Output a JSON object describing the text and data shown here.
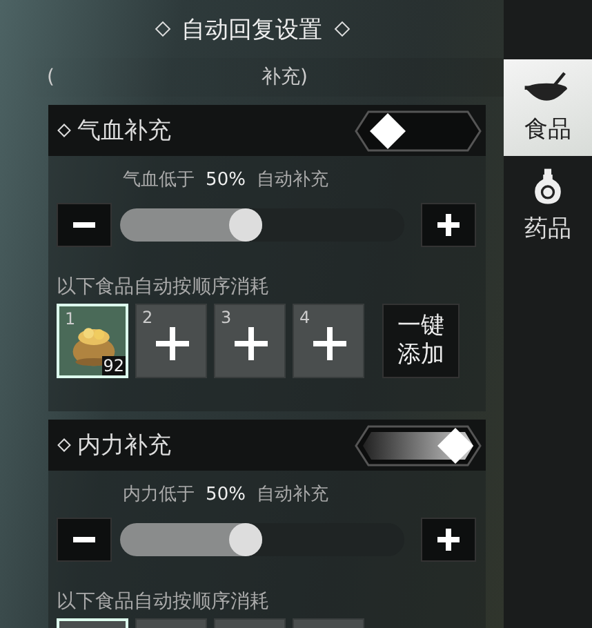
{
  "title": "自动回复设置",
  "note_fragments": [
    "(",
    "补充)"
  ],
  "tabs": [
    {
      "label": "食品",
      "selected": true,
      "kind": "bowl"
    },
    {
      "label": "药品",
      "selected": false,
      "kind": "bottle"
    }
  ],
  "sections": [
    {
      "title": "气血补充",
      "on": false,
      "threshold_label": "气血低于",
      "threshold_value": "50%",
      "threshold_suffix": "自动补充",
      "level": 0.5,
      "items_label": "以下食品自动按顺序消耗",
      "slots": [
        {
          "number": "1",
          "kind": "item",
          "count": "92",
          "selected": true
        },
        {
          "number": "2",
          "kind": "empty",
          "selected": false
        },
        {
          "number": "3",
          "kind": "empty",
          "selected": false
        },
        {
          "number": "4",
          "kind": "empty",
          "selected": false
        }
      ],
      "add_all": "一键添加"
    },
    {
      "title": "内力补充",
      "on": true,
      "threshold_label": "内力低于",
      "threshold_value": "50%",
      "threshold_suffix": "自动补充",
      "level": 0.5,
      "items_label": "以下食品自动按顺序消耗"
    }
  ]
}
